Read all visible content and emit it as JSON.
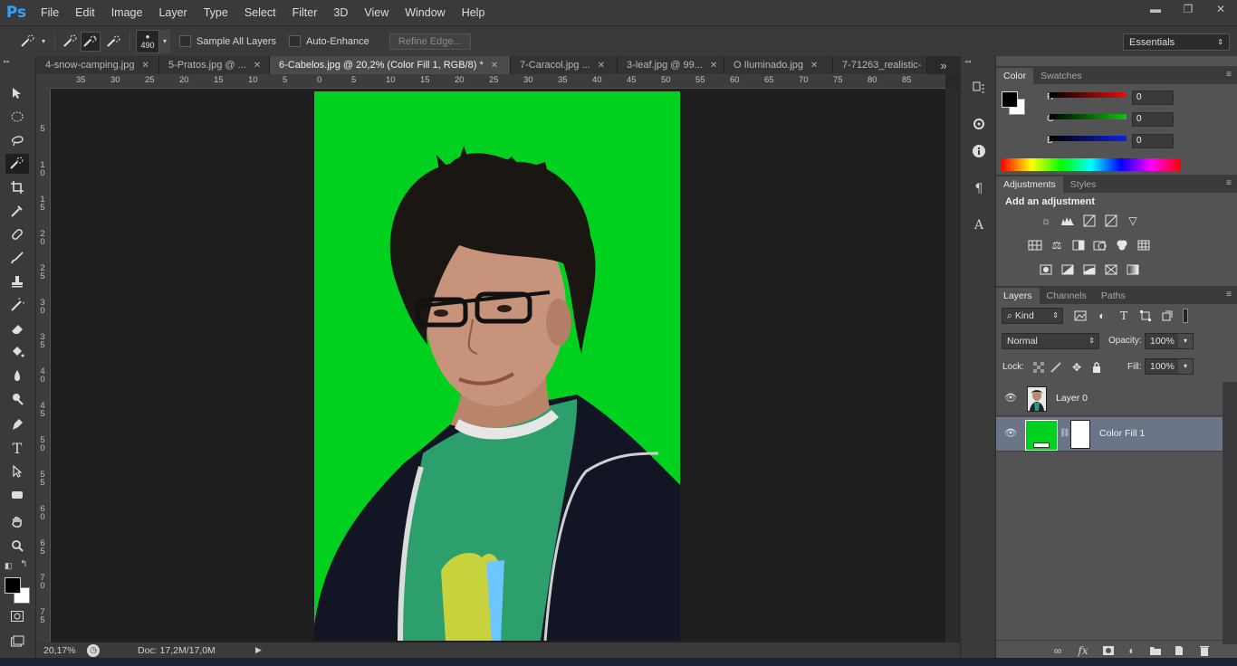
{
  "app": {
    "logo": "Ps"
  },
  "menu": [
    "File",
    "Edit",
    "Image",
    "Layer",
    "Type",
    "Select",
    "Filter",
    "3D",
    "View",
    "Window",
    "Help"
  ],
  "window_controls": {
    "minimize": "▬",
    "restore": "❐",
    "close": "✕"
  },
  "options": {
    "brush_size": "490",
    "sample_all_layers": "Sample All Layers",
    "auto_enhance": "Auto-Enhance",
    "refine_edge": "Refine Edge...",
    "workspace": "Essentials"
  },
  "tabs": [
    {
      "label": "4-snow-camping.jpg",
      "active": false
    },
    {
      "label": "5-Pratos.jpg @ ...",
      "active": false
    },
    {
      "label": "6-Cabelos.jpg @ 20,2% (Color Fill 1, RGB/8) *",
      "active": true
    },
    {
      "label": "7-Caracol.jpg ...",
      "active": false
    },
    {
      "label": "3-leaf.jpg @ 99...",
      "active": false
    },
    {
      "label": "O Iluminado.jpg",
      "active": false
    },
    {
      "label": "7-71263_realistic-",
      "active": false
    }
  ],
  "tab_overflow": "»",
  "ruler_top": [
    "35",
    "30",
    "25",
    "20",
    "15",
    "10",
    "5",
    "0",
    "5",
    "10",
    "15",
    "20",
    "25",
    "30",
    "35",
    "40",
    "45",
    "50",
    "55",
    "60",
    "65",
    "70",
    "75",
    "80",
    "85"
  ],
  "ruler_left": [
    "5",
    "1 0",
    "1 5",
    "2 0",
    "2 5",
    "3 0",
    "3 5",
    "4 0",
    "4 5",
    "5 0",
    "5 5",
    "6 0",
    "6 5",
    "7 0",
    "7 5"
  ],
  "status": {
    "zoom": "20,17%",
    "doc": "Doc: 17,2M/17,0M"
  },
  "color_panel": {
    "tabs": [
      "Color",
      "Swatches"
    ],
    "channels": [
      {
        "label": "R",
        "value": "0",
        "color": "#e01010"
      },
      {
        "label": "G",
        "value": "0",
        "color": "#10c010"
      },
      {
        "label": "B",
        "value": "0",
        "color": "#1020e0"
      }
    ]
  },
  "adjustments_panel": {
    "tabs": [
      "Adjustments",
      "Styles"
    ],
    "title": "Add an adjustment"
  },
  "layers_panel": {
    "tabs": [
      "Layers",
      "Channels",
      "Paths"
    ],
    "filter": "Kind",
    "blend_mode": "Normal",
    "opacity_label": "Opacity:",
    "opacity": "100%",
    "lock_label": "Lock:",
    "fill_label": "Fill:",
    "fill": "100%",
    "layers": [
      {
        "name": "Layer 0",
        "selected": false
      },
      {
        "name": "Color Fill 1",
        "selected": true
      }
    ]
  },
  "canvas": {
    "fill_color": "#00d11f"
  }
}
